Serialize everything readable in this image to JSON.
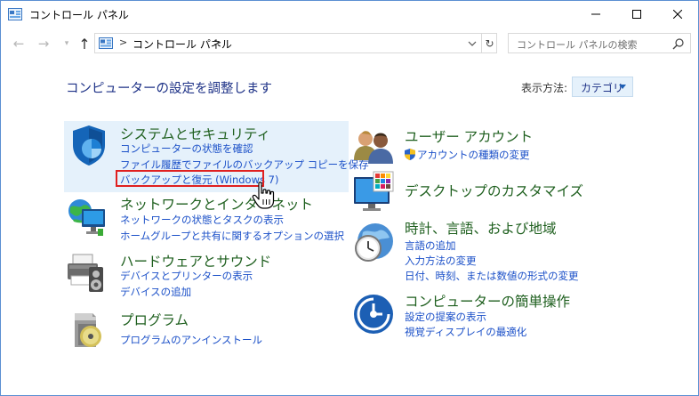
{
  "window": {
    "title": "コントロール パネル"
  },
  "address": {
    "separator": ">",
    "path": "コントロール パネル",
    "search_placeholder": "コントロール パネルの検索"
  },
  "main": {
    "heading": "コンピューターの設定を調整します",
    "view_by_label": "表示方法:",
    "view_by_value": "カテゴリ"
  },
  "categories": {
    "system": {
      "title": "システムとセキュリティ",
      "links": [
        "コンピューターの状態を確認",
        "ファイル履歴でファイルのバックアップ コピーを保存",
        "バックアップと復元 (Windows 7)"
      ]
    },
    "network": {
      "title": "ネットワークとインターネット",
      "links": [
        "ネットワークの状態とタスクの表示",
        "ホームグループと共有に関するオプションの選択"
      ]
    },
    "hardware": {
      "title": "ハードウェアとサウンド",
      "links": [
        "デバイスとプリンターの表示",
        "デバイスの追加"
      ]
    },
    "programs": {
      "title": "プログラム",
      "links": [
        "プログラムのアンインストール"
      ]
    },
    "user": {
      "title": "ユーザー アカウント",
      "links": [
        "アカウントの種類の変更"
      ]
    },
    "appearance": {
      "title": "デスクトップのカスタマイズ",
      "links": []
    },
    "clock": {
      "title": "時計、言語、および地域",
      "links": [
        "言語の追加",
        "入力方法の変更",
        "日付、時刻、または数値の形式の変更"
      ]
    },
    "ease": {
      "title": "コンピューターの簡単操作",
      "links": [
        "設定の提案の表示",
        "視覚ディスプレイの最適化"
      ]
    }
  }
}
